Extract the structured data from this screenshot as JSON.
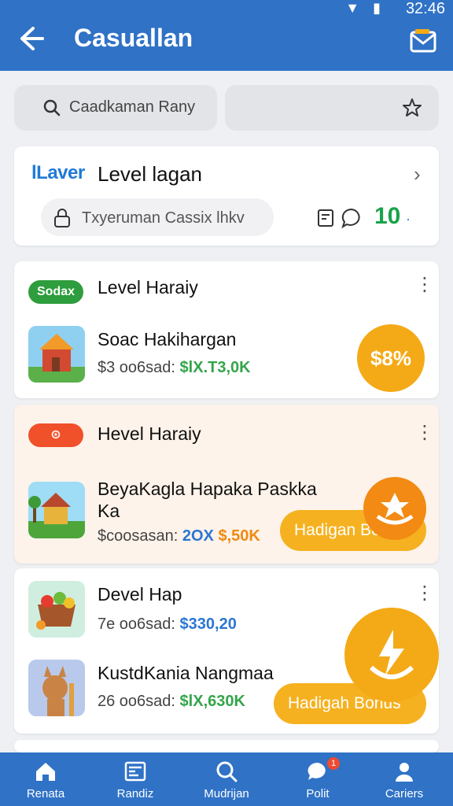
{
  "status_bar": {
    "time": "32:46",
    "icons": "▼ ▮"
  },
  "header": {
    "title": "Casuallan",
    "back_icon": "arrow-left-icon",
    "mail_icon": "mail-icon"
  },
  "search": {
    "placeholder": "Caadkaman Rany",
    "fav_icon": "star-icon"
  },
  "level_card": {
    "brand": "lLaver",
    "title": "Level lagan",
    "pill_text": "Txyeruman Cassix lhkv",
    "count": "10",
    "count_suffix": "·"
  },
  "sections": [
    {
      "badge": "Sodax",
      "heading": "Level Haraiy",
      "item": {
        "title": "Soac Hakihargan",
        "meta_prefix": "$3 oo6sad:",
        "meta_value": "$lX.T3,0K",
        "coin": "$8%"
      }
    },
    {
      "badge": "⊙",
      "heading": "Hevel Haraiy",
      "item": {
        "title": "BeyaKaglа Hapaka Paskka",
        "title2": "Ka",
        "meta_prefix": "$сoosasan:",
        "meta_value_a": "2OX",
        "meta_value_b": "$,50K",
        "cta": "Hadigan Bon"
      }
    },
    {
      "heading": "Devel Hap",
      "meta_prefix": "7e oo6sad:",
      "meta_value": "$330,20",
      "item2": {
        "title": "KustdKania Nangmaa",
        "meta_prefix": "26 oo6sad:",
        "meta_value": "$lX,630K",
        "cta": "Hadigah Bonus"
      }
    }
  ],
  "bottom_nav": [
    {
      "label": "Renata",
      "icon": "home-icon"
    },
    {
      "label": "Randiz",
      "icon": "list-icon"
    },
    {
      "label": "Mudrijan",
      "icon": "search-icon"
    },
    {
      "label": "Polit",
      "icon": "chat-icon",
      "badge": "1"
    },
    {
      "label": "Cariers",
      "icon": "profile-icon"
    }
  ],
  "colors": {
    "primary": "#2f72c6",
    "accent": "#f4aa17",
    "green": "#2e9d3d"
  }
}
